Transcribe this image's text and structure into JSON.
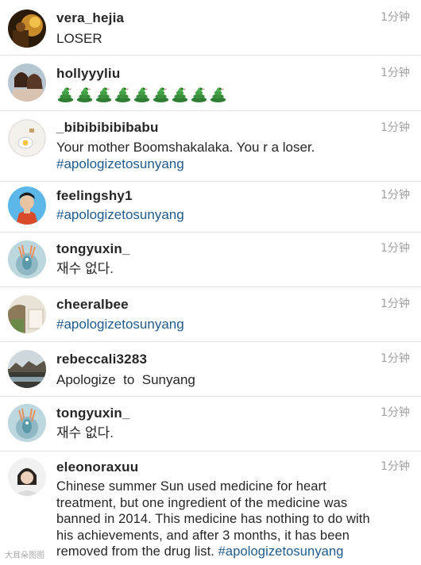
{
  "comments": [
    {
      "username": "vera_hejia",
      "time": "1分钟",
      "text": "LOSER"
    },
    {
      "username": "hollyyyliu",
      "time": "1分钟",
      "emoji": "snake",
      "emoji_count": 9
    },
    {
      "username": "_bibibibibibabu",
      "time": "1分钟",
      "text": "Your mother Boomshakalaka. You r a loser.",
      "hashtag": "#apologizetosunyang"
    },
    {
      "username": "feelingshy1",
      "time": "1分钟",
      "hashtag": "#apologizetosunyang"
    },
    {
      "username": "tongyuxin_",
      "time": "1分钟",
      "text": "재수 없다."
    },
    {
      "username": "cheeralbee",
      "time": "1分钟",
      "hashtag": "#apologizetosunyang"
    },
    {
      "username": "rebeccali3283",
      "time": "1分钟",
      "text": "Apologize  to  Sunyang"
    },
    {
      "username": "tongyuxin_",
      "time": "1分钟",
      "text": "재수 없다."
    },
    {
      "username": "eleonoraxuu",
      "time": "1分钟",
      "text": "Chinese summer Sun used medicine for heart treatment, but one ingredient of the medicine was banned in 2014. This medicine has nothing to do with his achievements, and after 3 months, it has been removed from the drug list. ",
      "hashtag": "#apologizetosunyang"
    }
  ],
  "watermark": "大耳朵图图",
  "colors": {
    "hashtag": "#1f5a8c",
    "username": "#262626",
    "time": "#a0a0a0",
    "divider": "#e4e4e4"
  }
}
